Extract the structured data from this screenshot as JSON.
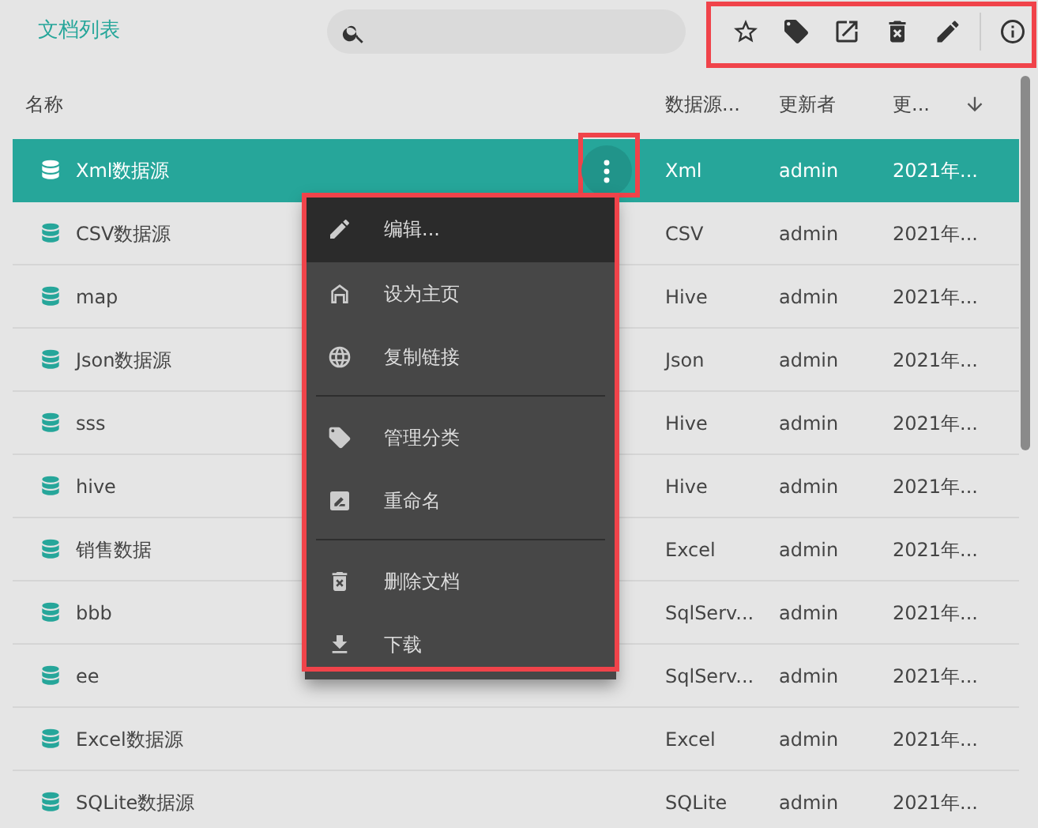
{
  "header": {
    "title": "文档列表",
    "toolbar_outlined": true
  },
  "columns": [
    {
      "label": "名称"
    },
    {
      "label": "数据源..."
    },
    {
      "label": "更新者"
    },
    {
      "label": "更...",
      "sorted": true
    }
  ],
  "rows": [
    {
      "name": "Xml数据源",
      "type": "Xml",
      "updater": "admin",
      "updated": "2021年...",
      "selected": true,
      "menu_button_outlined": true
    },
    {
      "name": "CSV数据源",
      "type": "CSV",
      "updater": "admin",
      "updated": "2021年...",
      "selected": false
    },
    {
      "name": "map",
      "type": "Hive",
      "updater": "admin",
      "updated": "2021年...",
      "selected": false
    },
    {
      "name": "Json数据源",
      "type": "Json",
      "updater": "admin",
      "updated": "2021年...",
      "selected": false
    },
    {
      "name": "sss",
      "type": "Hive",
      "updater": "admin",
      "updated": "2021年...",
      "selected": false
    },
    {
      "name": "hive",
      "type": "Hive",
      "updater": "admin",
      "updated": "2021年...",
      "selected": false
    },
    {
      "name": "销售数据",
      "type": "Excel",
      "updater": "admin",
      "updated": "2021年...",
      "selected": false
    },
    {
      "name": "bbb",
      "type": "SqlServ...",
      "updater": "admin",
      "updated": "2021年...",
      "selected": false
    },
    {
      "name": "ee",
      "type": "SqlServ...",
      "updater": "admin",
      "updated": "2021年...",
      "selected": false
    },
    {
      "name": "Excel数据源",
      "type": "Excel",
      "updater": "admin",
      "updated": "2021年...",
      "selected": false
    },
    {
      "name": "SQLite数据源",
      "type": "SQLite",
      "updater": "admin",
      "updated": "2021年...",
      "selected": false
    }
  ],
  "context_menu": {
    "outlined": true,
    "items": [
      {
        "kind": "item",
        "label": "编辑...",
        "selected": true
      },
      {
        "kind": "item",
        "label": "设为主页",
        "selected": false
      },
      {
        "kind": "item",
        "label": "复制链接",
        "selected": false
      },
      {
        "kind": "divider"
      },
      {
        "kind": "item",
        "label": "管理分类",
        "selected": false
      },
      {
        "kind": "item",
        "label": "重命名",
        "selected": false
      },
      {
        "kind": "divider"
      },
      {
        "kind": "item",
        "label": "删除文档",
        "selected": false
      },
      {
        "kind": "item",
        "label": "下载",
        "selected": false
      }
    ]
  }
}
